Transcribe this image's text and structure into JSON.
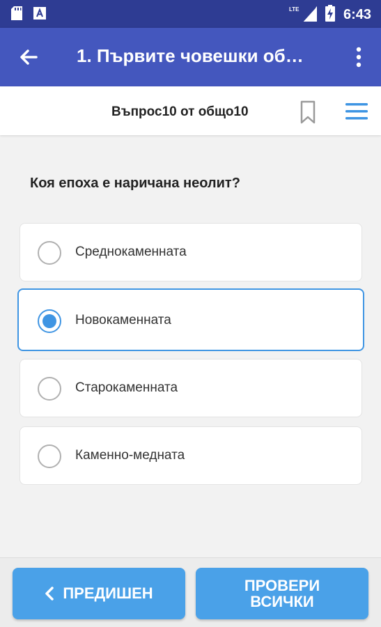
{
  "status_bar": {
    "network": "LTE",
    "time": "6:43"
  },
  "app_bar": {
    "title": "1. Първите човешки об…"
  },
  "progress": {
    "text": "Въпрос10 от общо10"
  },
  "question": {
    "text": "Коя епоха е наричана неолит?"
  },
  "options": [
    {
      "label": "Среднокаменната",
      "selected": false
    },
    {
      "label": "Новокаменната",
      "selected": true
    },
    {
      "label": "Старокаменната",
      "selected": false
    },
    {
      "label": "Каменно-медната",
      "selected": false
    }
  ],
  "buttons": {
    "previous": "ПРЕДИШЕН",
    "check_all": "ПРОВЕРИ ВСИЧКИ"
  },
  "colors": {
    "status_bar": "#2e3c93",
    "app_bar": "#4457be",
    "accent": "#3f95e3",
    "button": "#4aa1e8"
  }
}
